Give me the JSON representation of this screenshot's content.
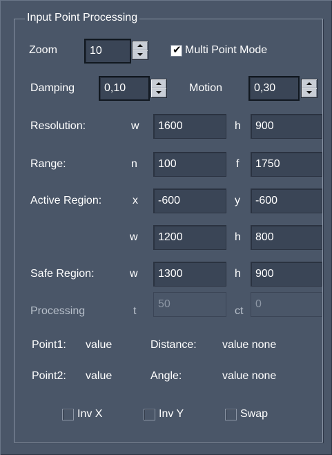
{
  "group": {
    "title": "Input Point Processing"
  },
  "zoom": {
    "label": "Zoom",
    "value": "10"
  },
  "multi_point": {
    "label": "Multi Point Mode",
    "checked": true
  },
  "damping": {
    "label": "Damping",
    "value": "0,10"
  },
  "motion": {
    "label": "Motion",
    "value": "0,30"
  },
  "resolution": {
    "label": "Resolution:",
    "w_label": "w",
    "w": "1600",
    "h_label": "h",
    "h": "900"
  },
  "range": {
    "label": "Range:",
    "n_label": "n",
    "n": "100",
    "f_label": "f",
    "f": "1750"
  },
  "active_region": {
    "label": "Active Region:",
    "x_label": "x",
    "x": "-600",
    "y_label": "y",
    "y": "-600",
    "w_label": "w",
    "w": "1200",
    "h_label": "h",
    "h": "800"
  },
  "safe_region": {
    "label": "Safe Region:",
    "w_label": "w",
    "w": "1300",
    "h_label": "h",
    "h": "900"
  },
  "processing": {
    "label": "Processing",
    "t_label": "t",
    "t": "50",
    "ct_label": "ct",
    "ct": "0"
  },
  "point1": {
    "label": "Point1:",
    "value": "value"
  },
  "point2": {
    "label": "Point2:",
    "value": "value"
  },
  "distance": {
    "label": "Distance:",
    "value": "value none"
  },
  "angle": {
    "label": "Angle:",
    "value": "value none"
  },
  "invx": {
    "label": "Inv X",
    "checked": false
  },
  "invy": {
    "label": "Inv Y",
    "checked": false
  },
  "swap": {
    "label": "Swap",
    "checked": false
  },
  "icons": {
    "spin_up": "spin-up-arrow-icon",
    "spin_down": "spin-down-arrow-icon",
    "check": "checkmark-icon"
  },
  "colors": {
    "background": "#4a5668",
    "field": "#3a4556",
    "text": "#ffffff"
  }
}
